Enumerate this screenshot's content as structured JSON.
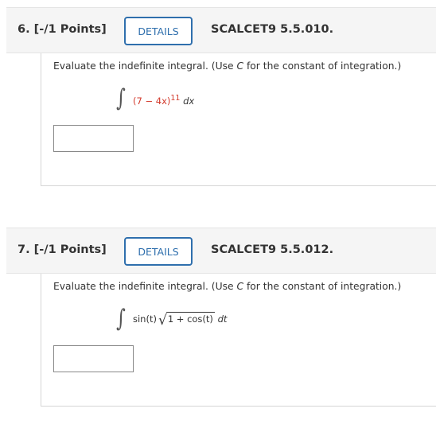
{
  "questions": [
    {
      "number_label": "6.  [-/1 Points]",
      "details_label": "DETAILS",
      "reference": "SCALCET9 5.5.010.",
      "prompt_prefix": "Evaluate the indefinite integral. (Use ",
      "prompt_var": "C",
      "prompt_suffix": " for the constant of integration.)",
      "integral_symbol": "∫",
      "integrand": {
        "base": "(7 − 4x)",
        "exponent": "11",
        "differential": "dx"
      },
      "answer_value": ""
    },
    {
      "number_label": "7.  [-/1 Points]",
      "details_label": "DETAILS",
      "reference": "SCALCET9 5.5.012.",
      "prompt_prefix": "Evaluate the indefinite integral. (Use ",
      "prompt_var": "C",
      "prompt_suffix": " for the constant of integration.)",
      "integral_symbol": "∫",
      "integrand": {
        "factor": "sin(t)",
        "radical_sign": "√",
        "radicand": "1 + cos(t)",
        "differential": "dt"
      },
      "answer_value": ""
    }
  ],
  "colors": {
    "header_background": "#f5f5f5",
    "details_button": "#2f6fad",
    "highlight_red": "#d33a2c"
  }
}
